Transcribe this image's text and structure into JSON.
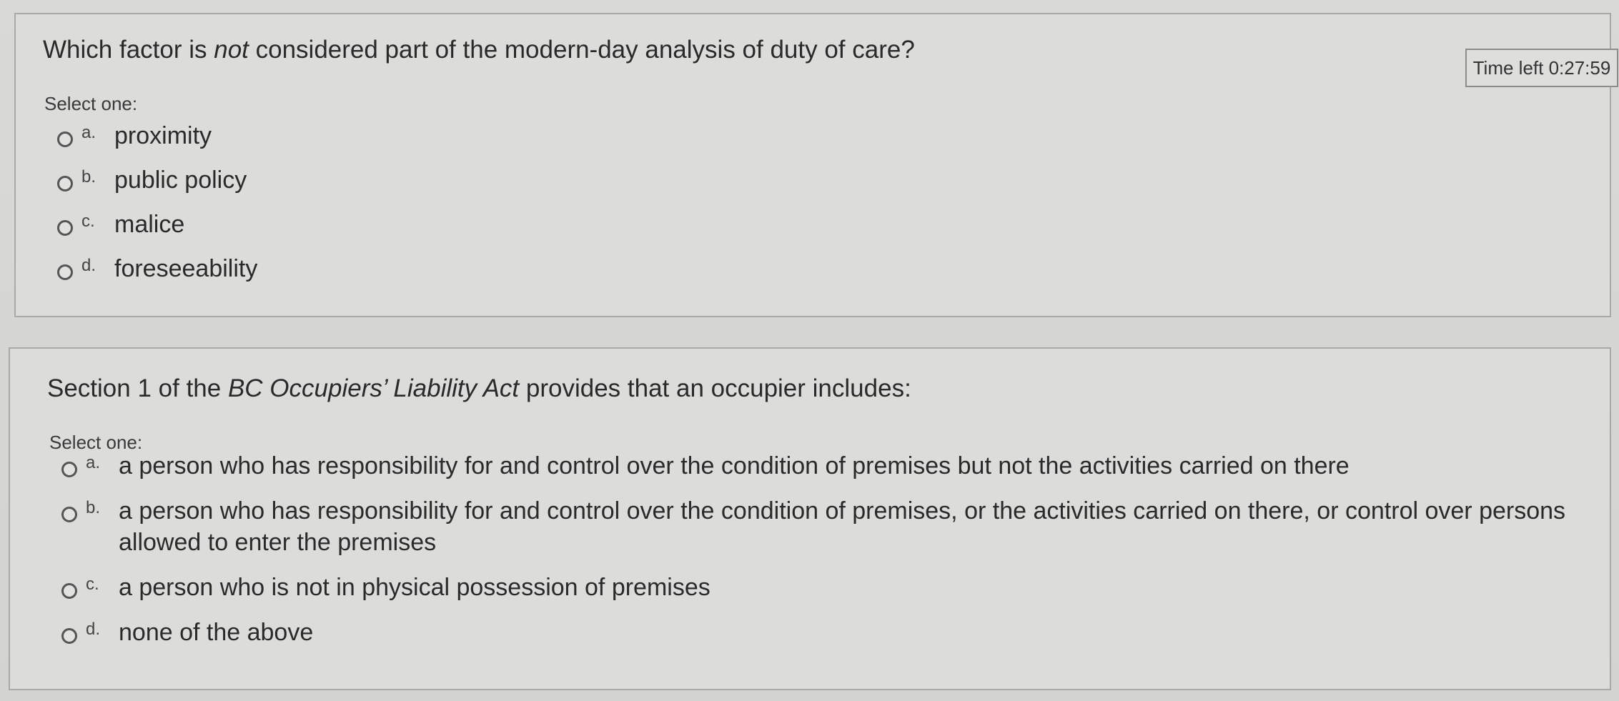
{
  "timer": {
    "label": "Time left 0:27:59"
  },
  "questions": [
    {
      "text": "Which factor is not considered part of the modern-day analysis of duty of care?",
      "text_parts": [
        "Which factor is ",
        "not",
        " considered part of the modern-day analysis of duty of care?"
      ],
      "select_label": "Select one:",
      "options": [
        {
          "letter": "a.",
          "text": "proximity"
        },
        {
          "letter": "b.",
          "text": "public policy"
        },
        {
          "letter": "c.",
          "text": "malice"
        },
        {
          "letter": "d.",
          "text": "foreseeability"
        }
      ]
    },
    {
      "text": "Section 1 of the BC Occupiers’ Liability Act provides that an occupier includes:",
      "text_parts": [
        "Section 1 of the ",
        "BC Occupiers’ Liability Act",
        " provides that an occupier includes:"
      ],
      "select_label": "Select one:",
      "options": [
        {
          "letter": "a.",
          "text": "a person who has responsibility for and control over the condition of premises but not the activities carried on there"
        },
        {
          "letter": "b.",
          "text": "a person who has responsibility for and control over the condition of premises, or the activities carried on there, or control over persons allowed to enter the premises"
        },
        {
          "letter": "c.",
          "text": "a person who is not in physical possession of premises"
        },
        {
          "letter": "d.",
          "text": "none of the above"
        }
      ]
    }
  ]
}
